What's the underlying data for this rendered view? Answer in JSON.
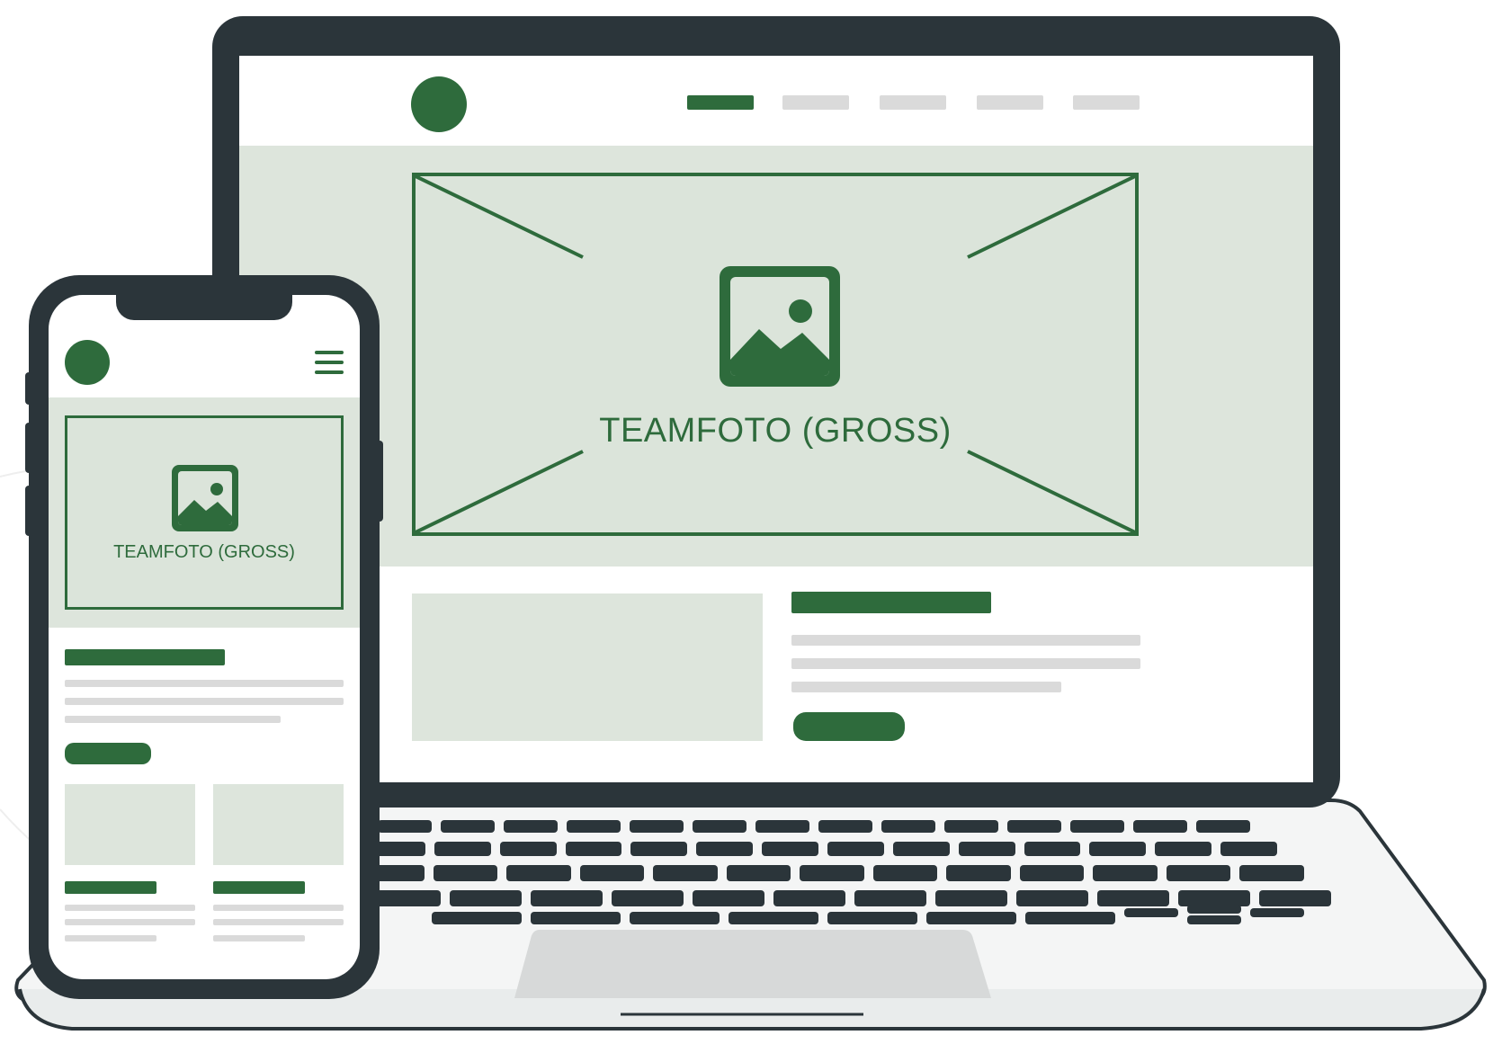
{
  "laptop": {
    "hero": {
      "label": "TEAMFOTO (GROSS)",
      "icon": "image-placeholder-icon"
    },
    "nav_active_index": 0
  },
  "phone": {
    "hero": {
      "label": "TEAMFOTO (GROSS)",
      "icon": "image-placeholder-icon"
    },
    "menu_icon": "hamburger-menu-icon"
  },
  "colors": {
    "brand_green": "#2e6b3c",
    "pale_green": "#dde5dc",
    "device_dark": "#2b353a",
    "placeholder_gray": "#dadada"
  }
}
